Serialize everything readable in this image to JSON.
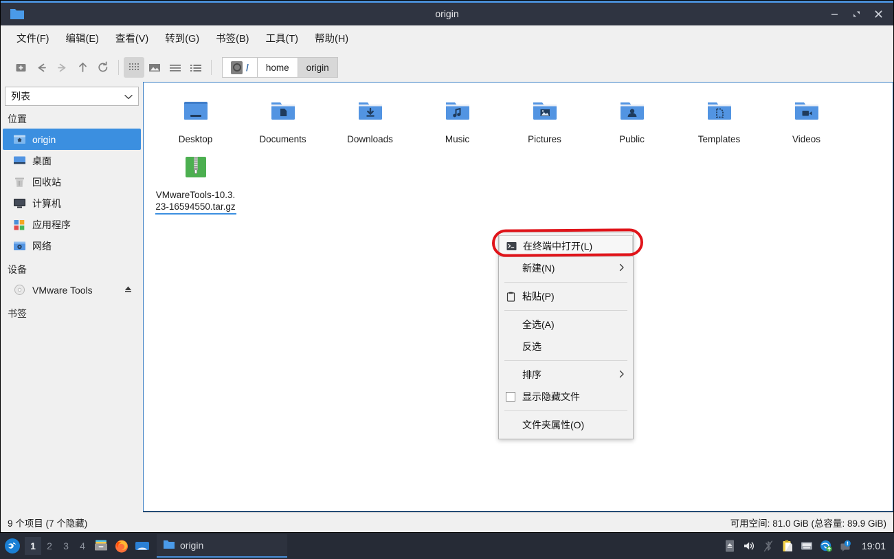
{
  "window": {
    "title": "origin",
    "icon": "folder-icon",
    "minimize_label": "–",
    "maximize_label": "⤡",
    "close_label": "✕"
  },
  "menubar": {
    "items": [
      {
        "label": "文件(F)",
        "name": "menu-file"
      },
      {
        "label": "编辑(E)",
        "name": "menu-edit"
      },
      {
        "label": "查看(V)",
        "name": "menu-view"
      },
      {
        "label": "转到(G)",
        "name": "menu-go"
      },
      {
        "label": "书签(B)",
        "name": "menu-bookmarks"
      },
      {
        "label": "工具(T)",
        "name": "menu-tools"
      },
      {
        "label": "帮助(H)",
        "name": "menu-help"
      }
    ]
  },
  "toolbar": {
    "buttons": [
      {
        "name": "open-terminal-here-icon"
      },
      {
        "name": "back-icon"
      },
      {
        "name": "forward-icon"
      },
      {
        "name": "up-icon"
      },
      {
        "name": "reload-icon"
      }
    ],
    "view_buttons": [
      {
        "name": "view-icons-icon",
        "active": true
      },
      {
        "name": "view-thumbnails-icon",
        "active": false
      },
      {
        "name": "view-compact-icon",
        "active": false
      },
      {
        "name": "view-details-icon",
        "active": false
      }
    ],
    "path": {
      "root_label": "/",
      "segments": [
        {
          "label": "home",
          "current": false
        },
        {
          "label": "origin",
          "current": true
        }
      ]
    }
  },
  "sidebar": {
    "view_mode": "列表",
    "groups": [
      {
        "title": "位置",
        "name": "sidebar-group-places",
        "items": [
          {
            "label": "origin",
            "icon": "home-folder-icon",
            "selected": true
          },
          {
            "label": "桌面",
            "icon": "desktop-icon",
            "selected": false
          },
          {
            "label": "回收站",
            "icon": "trash-icon",
            "selected": false
          },
          {
            "label": "计算机",
            "icon": "computer-icon",
            "selected": false
          },
          {
            "label": "应用程序",
            "icon": "applications-icon",
            "selected": false
          },
          {
            "label": "网络",
            "icon": "network-icon",
            "selected": false
          }
        ]
      },
      {
        "title": "设备",
        "name": "sidebar-group-devices",
        "items": [
          {
            "label": "VMware Tools",
            "icon": "optical-disc-icon",
            "selected": false,
            "eject": "⏏"
          }
        ]
      },
      {
        "title": "书签",
        "name": "sidebar-group-bookmarks",
        "items": []
      }
    ]
  },
  "files": [
    {
      "label": "Desktop",
      "icon": "folder-desktop-icon",
      "selected": false
    },
    {
      "label": "Documents",
      "icon": "folder-documents-icon",
      "selected": false
    },
    {
      "label": "Downloads",
      "icon": "folder-downloads-icon",
      "selected": false
    },
    {
      "label": "Music",
      "icon": "folder-music-icon",
      "selected": false
    },
    {
      "label": "Pictures",
      "icon": "folder-pictures-icon",
      "selected": false
    },
    {
      "label": "Public",
      "icon": "folder-public-icon",
      "selected": false
    },
    {
      "label": "Templates",
      "icon": "folder-templates-icon",
      "selected": false
    },
    {
      "label": "Videos",
      "icon": "folder-videos-icon",
      "selected": false
    },
    {
      "label": "VMwareTools-10.3.23-16594550.tar.gz",
      "icon": "archive-icon",
      "selected": true
    }
  ],
  "context_menu": {
    "items": [
      {
        "label": "在终端中打开(L)",
        "name": "ctx-open-in-terminal",
        "icon": "terminal-icon",
        "highlight": true
      },
      {
        "label": "新建(N)",
        "name": "ctx-new",
        "submenu": true
      },
      {
        "separator": true
      },
      {
        "label": "粘贴(P)",
        "name": "ctx-paste",
        "icon": "clipboard-icon"
      },
      {
        "separator": true
      },
      {
        "label": "全选(A)",
        "name": "ctx-select-all"
      },
      {
        "label": "反选",
        "name": "ctx-invert-selection"
      },
      {
        "separator": true
      },
      {
        "label": "排序",
        "name": "ctx-sort",
        "submenu": true
      },
      {
        "label": "显示隐藏文件",
        "name": "ctx-show-hidden",
        "checkbox": true,
        "checked": false
      },
      {
        "separator": true
      },
      {
        "label": "文件夹属性(O)",
        "name": "ctx-folder-properties"
      }
    ],
    "annotation_color": "#e0141a"
  },
  "statusbar": {
    "left": "9 个项目 (7 个隐藏)",
    "right": "可用空间: 81.0 GiB (总容量: 89.9 GiB)"
  },
  "taskbar": {
    "launcher": "deepin-launcher-icon",
    "workspaces": [
      {
        "label": "1",
        "active": true
      },
      {
        "label": "2",
        "active": false
      },
      {
        "label": "3",
        "active": false
      },
      {
        "label": "4",
        "active": false
      }
    ],
    "quick_launch": [
      {
        "name": "file-archive-icon"
      },
      {
        "name": "firefox-icon"
      },
      {
        "name": "deepin-store-icon"
      }
    ],
    "tasks": [
      {
        "label": "origin",
        "icon": "folder-icon",
        "active": true
      }
    ],
    "tray": [
      {
        "name": "eject-icon"
      },
      {
        "name": "volume-icon"
      },
      {
        "name": "bluetooth-disabled-icon"
      },
      {
        "name": "clipboard-tray-icon"
      },
      {
        "name": "keyboard-icon"
      },
      {
        "name": "network-update-icon"
      },
      {
        "name": "notification-icon"
      }
    ],
    "clock": "19:01"
  },
  "colors": {
    "titlebar_bg": "#2f3441",
    "titlebar_accent": "#4a90d9",
    "selection_blue": "#3b8fe0",
    "folder_blue": "#5294e2",
    "folder_dark": "#1f3b5c",
    "archive_green": "#4caf50",
    "taskbar_bg": "#262b36"
  }
}
